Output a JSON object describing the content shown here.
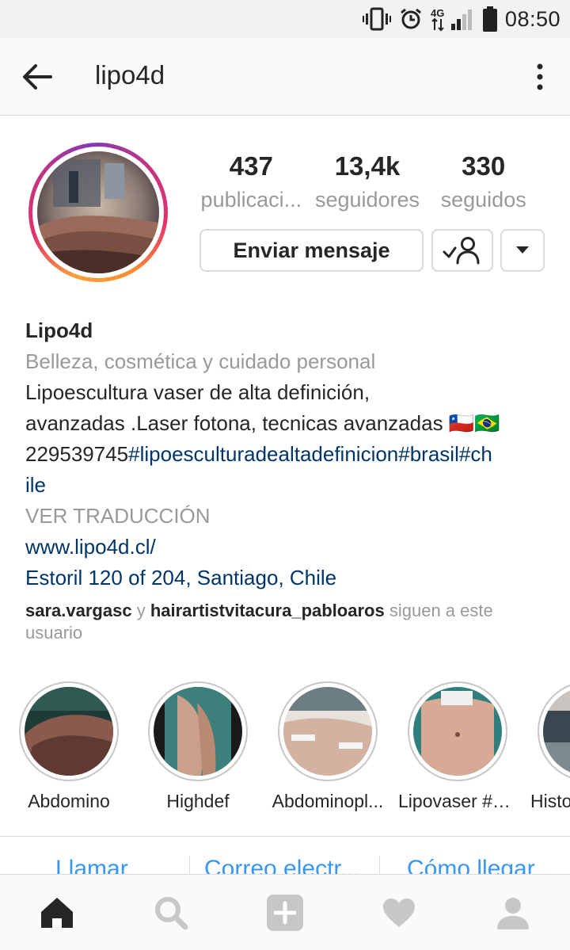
{
  "status_bar": {
    "time": "08:50",
    "icons": [
      "vibrate-icon",
      "alarm-icon",
      "4g-signal-icon",
      "battery-icon"
    ],
    "network_label": "4G"
  },
  "app_bar": {
    "title": "lipo4d",
    "back_icon": "arrow-left-icon",
    "more_icon": "more-vertical-icon"
  },
  "profile": {
    "stats": [
      {
        "value": "437",
        "label": "publicaci..."
      },
      {
        "value": "13,4k",
        "label": "seguidores"
      },
      {
        "value": "330",
        "label": "seguidos"
      }
    ],
    "message_button": "Enviar mensaje",
    "follow_icon": "following-check-icon",
    "dropdown_icon": "caret-down-icon"
  },
  "bio": {
    "name": "Lipo4d",
    "category": "Belleza, cosmética y cuidado personal",
    "line1": "Lipoescultura vaser de alta definición,",
    "line2": "avanzadas .Laser fotona, tecnicas avanzadas",
    "flags": "🇨🇱🇧🇷",
    "phone": "229539745",
    "hashtags_a": "#lipoesculturadealtadefinicion#brasil#ch",
    "hashtags_b": "ile",
    "translate": "VER TRADUCCIÓN",
    "website": "www.lipo4d.cl/",
    "address": "Estoril 120 of 204, Santiago, Chile"
  },
  "followed_by": {
    "user1": "sara.vargasc",
    "connector": "y",
    "user2": "hairartistvitacura_pabloaros",
    "suffix": "siguen a este usuario"
  },
  "highlights": [
    {
      "label": "Abdomino"
    },
    {
      "label": "Highdef"
    },
    {
      "label": "Abdominopl..."
    },
    {
      "label": "Lipovaser #b..."
    },
    {
      "label": "Histo"
    }
  ],
  "contact_buttons": [
    {
      "label": "Llamar"
    },
    {
      "label": "Correo electr..."
    },
    {
      "label": "Cómo llegar"
    }
  ],
  "bottom_nav": [
    {
      "icon": "home-icon"
    },
    {
      "icon": "search-icon"
    },
    {
      "icon": "add-post-icon"
    },
    {
      "icon": "heart-icon"
    },
    {
      "icon": "profile-icon"
    }
  ],
  "colors": {
    "link": "#003569",
    "muted": "#999999",
    "text": "#262626",
    "accent_blue": "#3897f0"
  }
}
